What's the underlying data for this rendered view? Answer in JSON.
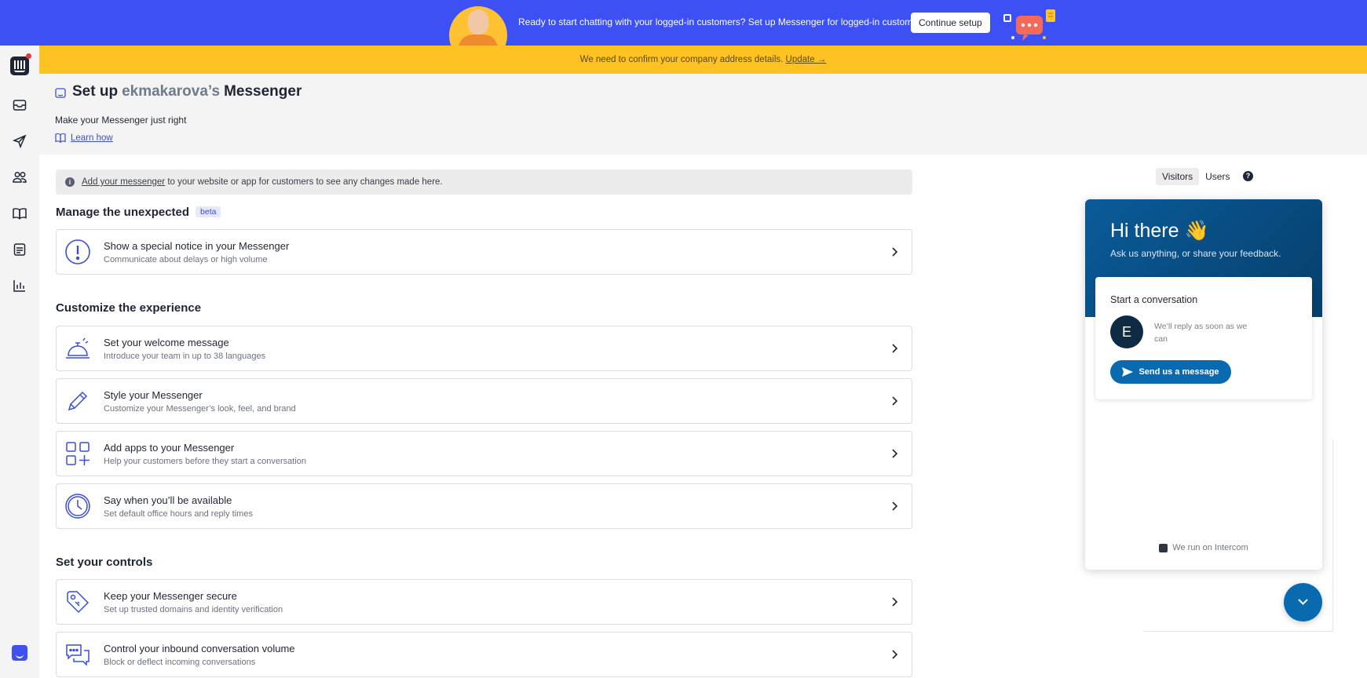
{
  "promo": {
    "text": "Ready to start chatting with your logged-in customers? Set up Messenger for logged-in customers",
    "button_label": "Continue setup"
  },
  "notice": {
    "text": "We need to confirm your company address details.",
    "link_label": "Update →"
  },
  "rail": {
    "icons": [
      "intercom-logo-icon",
      "inbox-icon",
      "outbound-icon",
      "contacts-icon",
      "articles-icon",
      "messenger-icon",
      "reports-icon",
      "chat-icon"
    ]
  },
  "header": {
    "title_prefix": "Set up",
    "title_name": "ekmakarova’s",
    "title_suffix": "Messenger",
    "subtitle": "Make your Messenger just right",
    "learn_label": "Learn how"
  },
  "info_bar": {
    "link_label": "Add your messenger",
    "text": " to your website or app for customers to see any changes made here."
  },
  "sections": {
    "unexpected": {
      "title": "Manage the unexpected",
      "badge": "beta"
    },
    "customize": {
      "title": "Customize the experience"
    },
    "controls": {
      "title": "Set your controls"
    }
  },
  "cards": {
    "notice": {
      "title": "Show a special notice in your Messenger",
      "desc": "Communicate about delays or high volume"
    },
    "welcome": {
      "title": "Set your welcome message",
      "desc": "Introduce your team in up to 38 languages"
    },
    "style": {
      "title": "Style your Messenger",
      "desc": "Customize your Messenger’s look, feel, and brand"
    },
    "apps": {
      "title": "Add apps to your Messenger",
      "desc": "Help your customers before they start a conversation"
    },
    "available": {
      "title": "Say when you’ll be available",
      "desc": "Set default office hours and reply times"
    },
    "secure": {
      "title": "Keep your Messenger secure",
      "desc": "Set up trusted domains and identity verification"
    },
    "inbound": {
      "title": "Control your inbound conversation volume",
      "desc": "Block or deflect incoming conversations"
    }
  },
  "preview": {
    "toggle": {
      "visitors": "Visitors",
      "users": "Users"
    },
    "help": "?",
    "greeting": "Hi there 👋",
    "greeting_sub": "Ask us anything, or share your feedback.",
    "card_title": "Start a conversation",
    "avatar_letter": "E",
    "reply_text": "We’ll reply as soon as we can",
    "send_label": "Send us a message",
    "footer": "We run on Intercom"
  },
  "colors": {
    "promo_bg": "#3c50f4",
    "notice_bg": "#fec322",
    "accent": "#3b4fd0",
    "messenger_brand": "#0a6ab0"
  }
}
